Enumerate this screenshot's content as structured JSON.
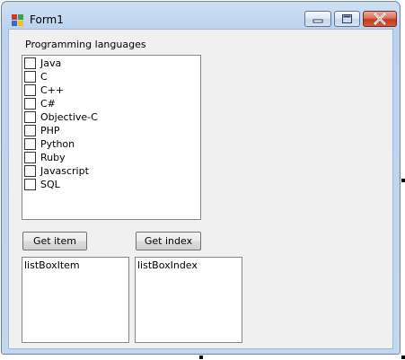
{
  "window": {
    "title": "Form1",
    "icon": "winforms-app-icon",
    "controls": {
      "minimize": "minimize-icon",
      "maximize": "maximize-icon",
      "close": "close-icon"
    }
  },
  "form": {
    "label": "Programming languages",
    "checked_list": {
      "items": [
        {
          "label": "Java",
          "checked": false
        },
        {
          "label": "C",
          "checked": false
        },
        {
          "label": "C++",
          "checked": false
        },
        {
          "label": "C#",
          "checked": false
        },
        {
          "label": "Objective-C",
          "checked": false
        },
        {
          "label": "PHP",
          "checked": false
        },
        {
          "label": "Python",
          "checked": false
        },
        {
          "label": "Ruby",
          "checked": false
        },
        {
          "label": "Javascript",
          "checked": false
        },
        {
          "label": "SQL",
          "checked": false
        }
      ]
    },
    "buttons": {
      "get_item": "Get item",
      "get_index": "Get index"
    },
    "listboxes": {
      "item": "listBoxItem",
      "index": "listBoxIndex"
    }
  },
  "colors": {
    "client_background": "#f0f0f0",
    "close_button": "#c23b20",
    "window_frame": "#bcd3ee"
  }
}
